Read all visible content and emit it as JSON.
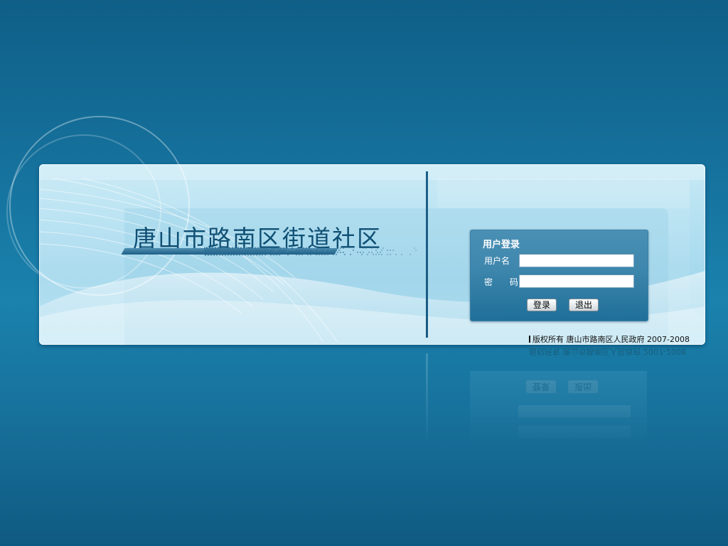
{
  "page": {
    "site_title": "唐山市路南区街道社区"
  },
  "login": {
    "title": "用户登录",
    "username_label": "用户名",
    "username_value": "",
    "password_label": "密 码",
    "password_value": "",
    "login_button": "登录",
    "exit_button": "退出"
  },
  "footer": {
    "copyright": "版权所有  唐山市路南区人民政府  2007-2008"
  },
  "colors": {
    "background_top": "#0f5f87",
    "background_mid": "#1a82ad",
    "panel": "#b3e0f1",
    "title_text": "#0f4f73",
    "login_box": "#3f87ad",
    "divider": "#1d5f88"
  },
  "icons": {
    "decor_circles": "concentric-arcs-decoration",
    "title_underline": "slanted-bar-with-halftone-dots"
  }
}
